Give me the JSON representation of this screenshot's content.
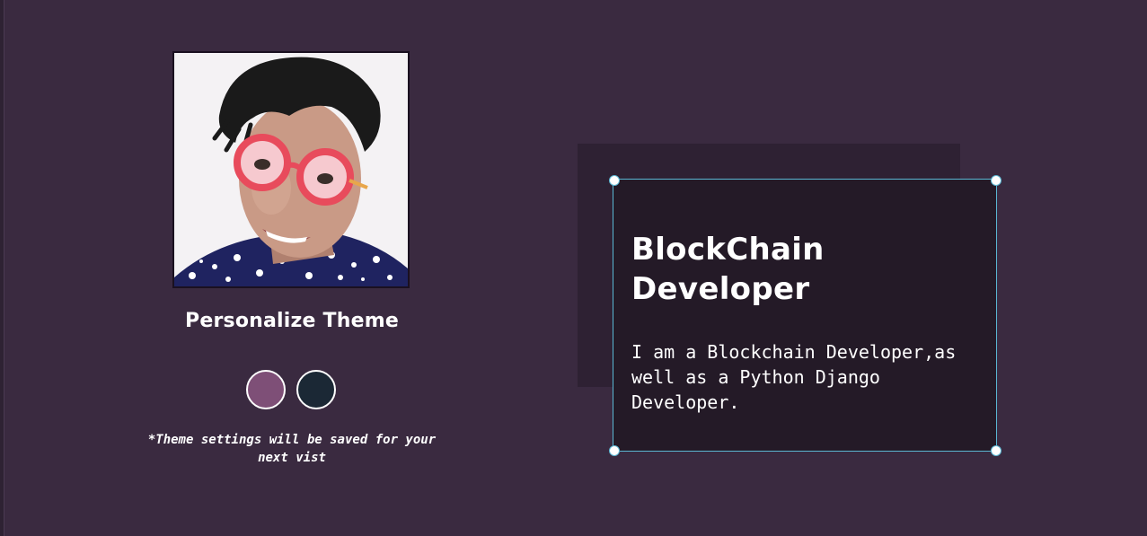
{
  "theme": {
    "title": "Personalize Theme",
    "note": "*Theme settings will be saved for your next vist",
    "swatches": [
      {
        "color": "#7e4f77"
      },
      {
        "color": "#1b2835"
      }
    ]
  },
  "intro": {
    "title": "BlockChain Developer",
    "text": "I am a Blockchain Developer,as well as a Python Django Developer."
  },
  "colors": {
    "background": "#3a2a40",
    "card": "#241a27",
    "card_shadow": "#2e2133",
    "selection_outline": "#5ab7d3"
  }
}
